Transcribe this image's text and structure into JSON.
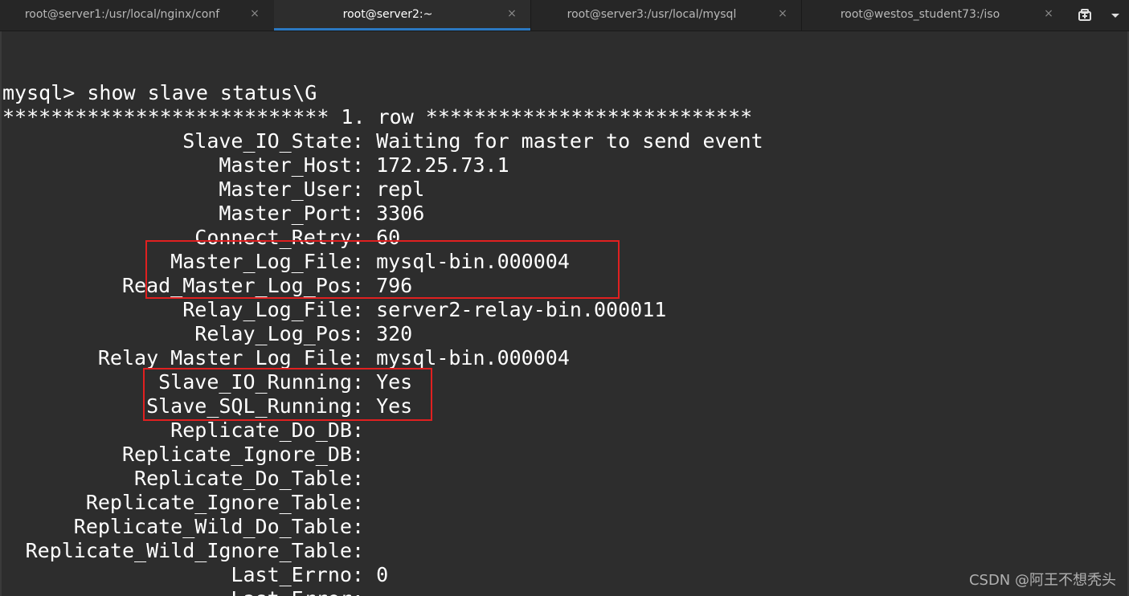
{
  "tabs": [
    {
      "label": "root@server1:/usr/local/nginx/conf",
      "close": "×",
      "active": false
    },
    {
      "label": "root@server2:~",
      "close": "×",
      "active": true
    },
    {
      "label": "root@server3:/usr/local/mysql",
      "close": "×",
      "active": false
    },
    {
      "label": "root@westos_student73:/iso",
      "close": "×",
      "active": false
    }
  ],
  "toolbar": {
    "new_tab_icon": "new-tab-icon",
    "menu_icon": "dropdown-icon"
  },
  "terminal": {
    "prompt_line": "mysql> show slave status\\G",
    "row_header": "*************************** 1. row ***************************",
    "fields": [
      {
        "name": "Slave_IO_State:",
        "value": "Waiting for master to send event"
      },
      {
        "name": "Master_Host:",
        "value": "172.25.73.1"
      },
      {
        "name": "Master_User:",
        "value": "repl"
      },
      {
        "name": "Master_Port:",
        "value": "3306"
      },
      {
        "name": "Connect_Retry:",
        "value": "60"
      },
      {
        "name": "Master_Log_File:",
        "value": "mysql-bin.000004"
      },
      {
        "name": "Read_Master_Log_Pos:",
        "value": "796"
      },
      {
        "name": "Relay_Log_File:",
        "value": "server2-relay-bin.000011"
      },
      {
        "name": "Relay_Log_Pos:",
        "value": "320"
      },
      {
        "name": "Relay_Master_Log_File:",
        "value": "mysql-bin.000004"
      },
      {
        "name": "Slave_IO_Running:",
        "value": "Yes"
      },
      {
        "name": "Slave_SQL_Running:",
        "value": "Yes"
      },
      {
        "name": "Replicate_Do_DB:",
        "value": ""
      },
      {
        "name": "Replicate_Ignore_DB:",
        "value": ""
      },
      {
        "name": "Replicate_Do_Table:",
        "value": ""
      },
      {
        "name": "Replicate_Ignore_Table:",
        "value": ""
      },
      {
        "name": "Replicate_Wild_Do_Table:",
        "value": ""
      },
      {
        "name": "Replicate_Wild_Ignore_Table:",
        "value": ""
      },
      {
        "name": "Last_Errno:",
        "value": "0"
      },
      {
        "name": "Last_Error:",
        "value": ""
      }
    ]
  },
  "colors": {
    "background": "#2d2d2d",
    "text": "#ffffff",
    "highlight": "#e02020",
    "active_tab_underline": "#2b79c2"
  },
  "watermark": "CSDN @阿王不想秃头"
}
